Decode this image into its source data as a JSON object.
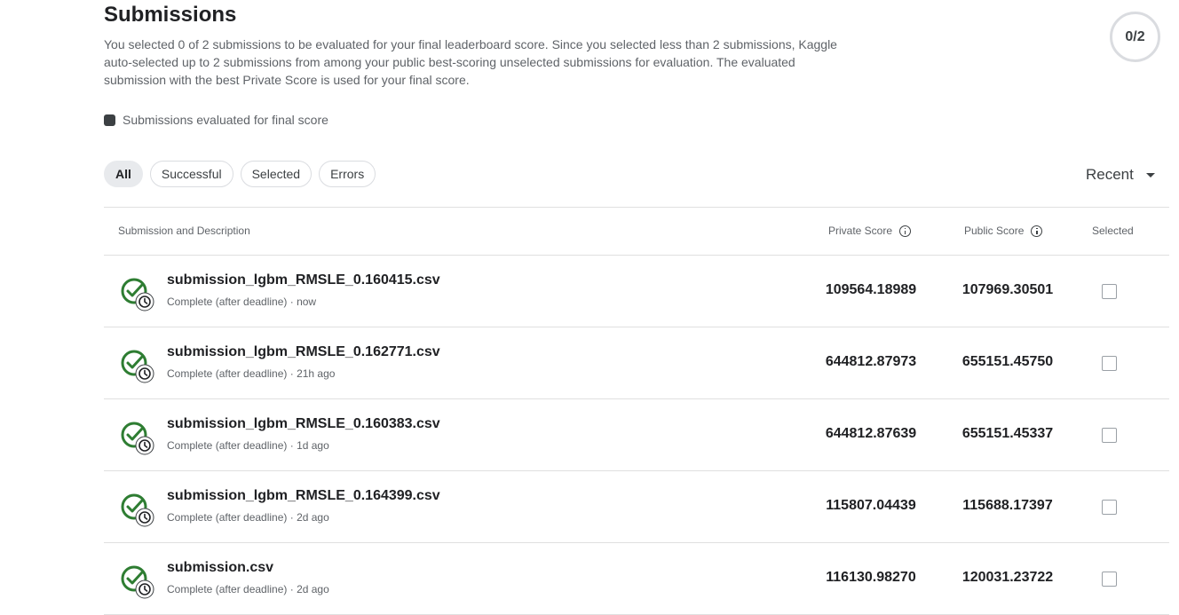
{
  "header": {
    "title": "Submissions",
    "description": "You selected 0 of 2 submissions to be evaluated for your final leaderboard score. Since you selected less than 2 submissions, Kaggle auto-selected up to 2 submissions from among your public best-scoring unselected submissions for evaluation. The evaluated submission with the best Private Score is used for your final score.",
    "counter": "0/2",
    "legend": "Submissions evaluated for final score"
  },
  "filters": [
    "All",
    "Successful",
    "Selected",
    "Errors"
  ],
  "active_filter": "All",
  "sort": {
    "label": "Recent"
  },
  "table": {
    "columns": {
      "submission": "Submission and Description",
      "private": "Private Score",
      "public": "Public Score",
      "selected": "Selected"
    },
    "rows": [
      {
        "name": "submission_lgbm_RMSLE_0.160415.csv",
        "meta": "Complete (after deadline) · now",
        "private": "109564.18989",
        "public": "107969.30501"
      },
      {
        "name": "submission_lgbm_RMSLE_0.162771.csv",
        "meta": "Complete (after deadline) · 21h ago",
        "private": "644812.87973",
        "public": "655151.45750"
      },
      {
        "name": "submission_lgbm_RMSLE_0.160383.csv",
        "meta": "Complete (after deadline) · 1d ago",
        "private": "644812.87639",
        "public": "655151.45337"
      },
      {
        "name": "submission_lgbm_RMSLE_0.164399.csv",
        "meta": "Complete (after deadline) · 2d ago",
        "private": "115807.04439",
        "public": "115688.17397"
      },
      {
        "name": "submission.csv",
        "meta": "Complete (after deadline) · 2d ago",
        "private": "116130.98270",
        "public": "120031.23722"
      }
    ]
  },
  "colors": {
    "success": "#2e7d32",
    "text": "#202124",
    "muted": "#5f6368"
  },
  "icons": {
    "status": "check-clock-icon",
    "info": "info-icon",
    "sort": "caret-down-icon"
  }
}
